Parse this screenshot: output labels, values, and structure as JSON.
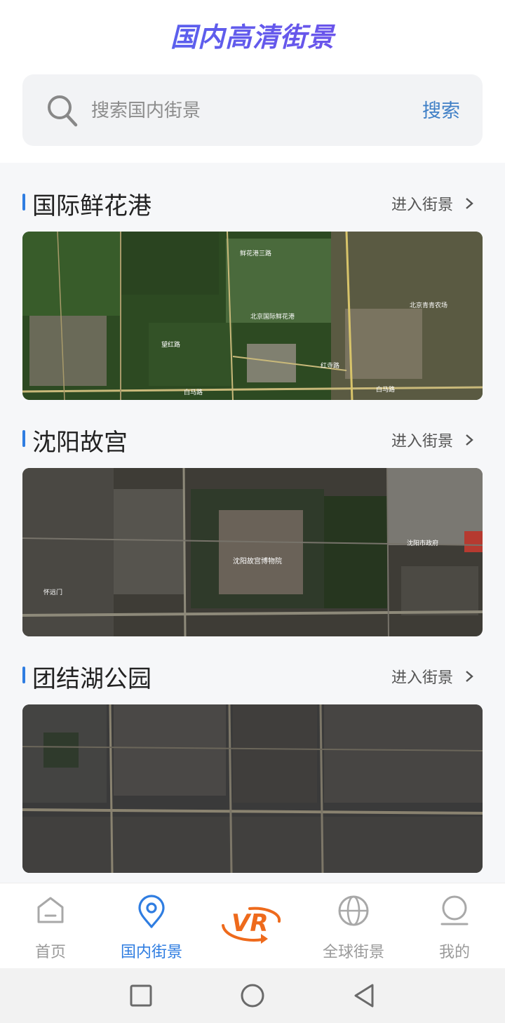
{
  "header": {
    "title": "国内高清街景"
  },
  "search": {
    "placeholder": "搜索国内街景",
    "button_label": "搜索"
  },
  "sections": [
    {
      "title": "国际鲜花港",
      "link_label": "进入街景",
      "map_labels": [
        "鲜花港三路",
        "北京国际鲜花港",
        "北京青青农场",
        "红寺路",
        "白马路",
        "白马路",
        "望红路"
      ]
    },
    {
      "title": "沈阳故宫",
      "link_label": "进入街景",
      "map_labels": [
        "沈阳故宫博物院",
        "沈阳市政府",
        "怀远门"
      ]
    },
    {
      "title": "团结湖公园",
      "link_label": "进入街景",
      "map_labels": []
    }
  ],
  "tabs": [
    {
      "label": "首页",
      "icon": "home-icon",
      "active": false
    },
    {
      "label": "国内街景",
      "icon": "location-pin-icon",
      "active": true
    },
    {
      "label": "VR",
      "icon": "vr-logo-icon",
      "active": false
    },
    {
      "label": "全球街景",
      "icon": "globe-icon",
      "active": false
    },
    {
      "label": "我的",
      "icon": "profile-icon",
      "active": false
    }
  ],
  "colors": {
    "accent": "#2f7de1",
    "title_gradient_start": "#4b6cf0",
    "title_gradient_end": "#7a48e8",
    "vr_orange": "#ee6a1c"
  }
}
